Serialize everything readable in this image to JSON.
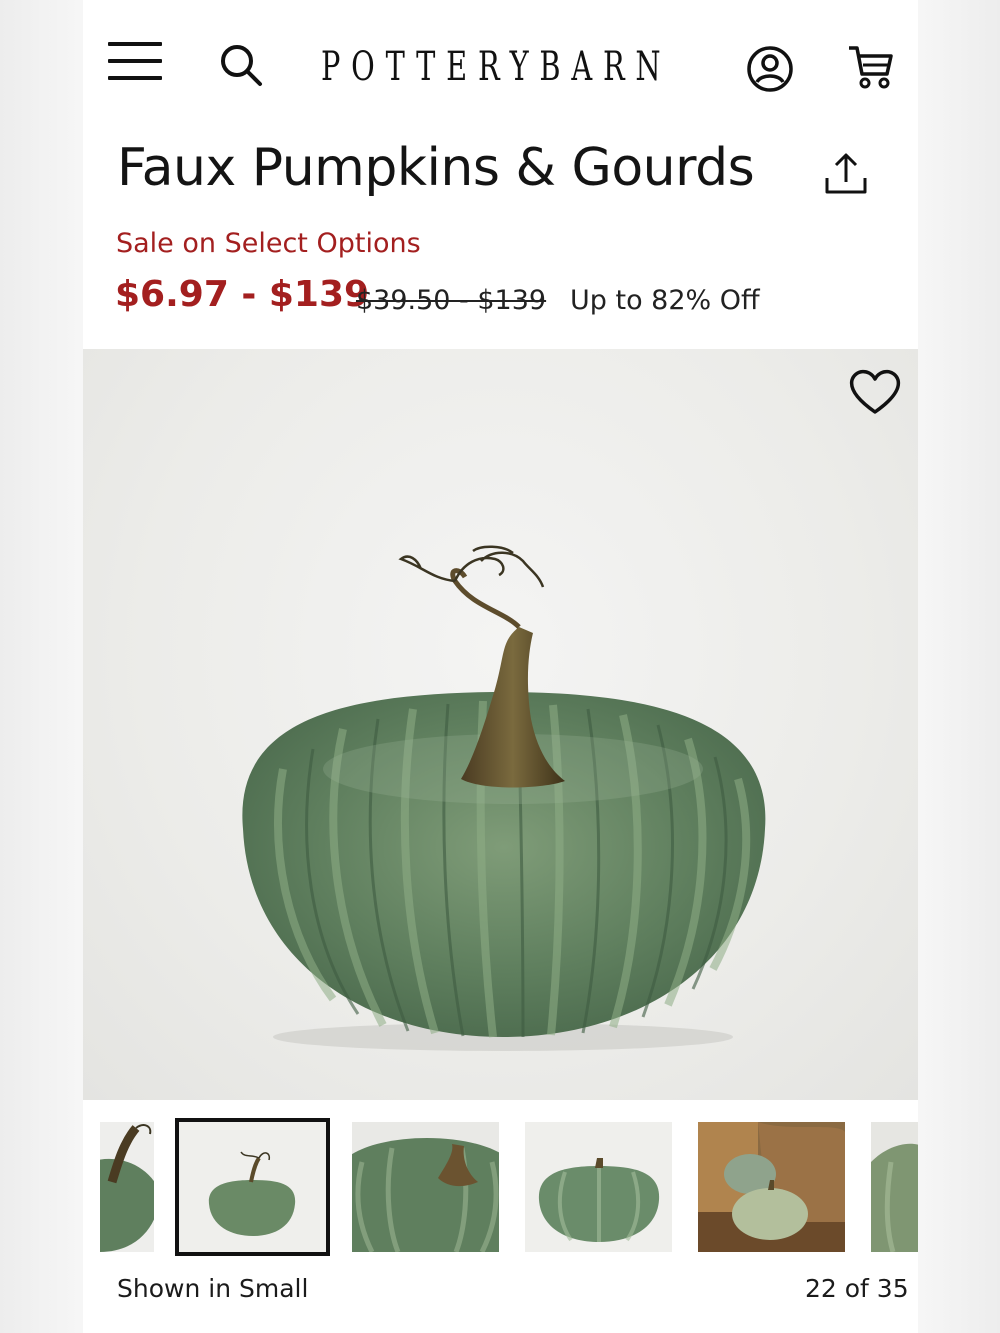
{
  "header": {
    "logo": "POTTERYBARN",
    "icons": [
      "menu-icon",
      "search-icon",
      "account-icon",
      "cart-icon"
    ]
  },
  "product": {
    "title": "Faux Pumpkins & Gourds",
    "sale_label": "Sale on Select Options",
    "sale_price": "$6.97 - $139",
    "original_price": "$39.50 - $139",
    "discount": "Up to 82% Off"
  },
  "gallery": {
    "caption": "Shown in Small",
    "counter": "22 of 35",
    "selected_index": 1
  },
  "colors": {
    "sale": "#a31f1f",
    "text": "#141414",
    "pumpkin_green": "#6f8f6c"
  }
}
